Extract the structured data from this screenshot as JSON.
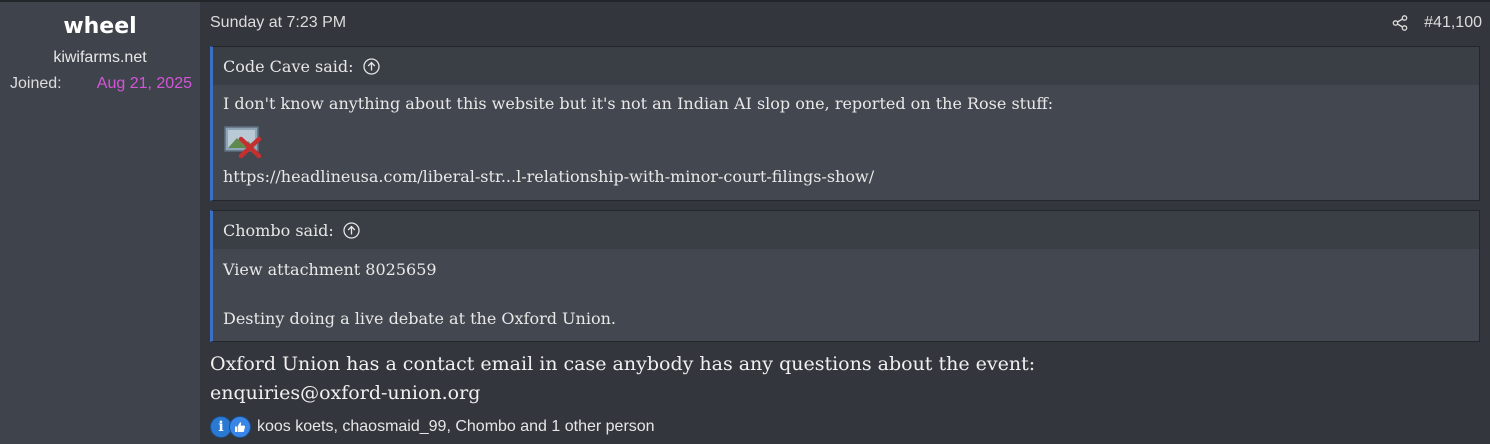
{
  "user": {
    "name": "wheel",
    "title": "kiwifarms.net",
    "joined_label": "Joined:",
    "joined_date": "Aug 21, 2025"
  },
  "post": {
    "date": "Sunday at 7:23 PM",
    "number": "#41,100",
    "quotes": [
      {
        "author": "Code Cave said:",
        "line1": "I don't know anything about this website but it's not an Indian AI slop one, reported on the Rose stuff:",
        "link": "https://headlineusa.com/liberal-str...l-relationship-with-minor-court-filings-show/"
      },
      {
        "author": "Chombo said:",
        "line1": "View attachment 8025659",
        "line2": "Destiny doing a live debate at the Oxford Union."
      }
    ],
    "body_line1": "Oxford Union has a contact email in case anybody has any questions about the event:",
    "body_line2": "enquiries@oxford-union.org",
    "reactions_text": "koos koets, chaosmaid_99, Chombo and 1 other person"
  },
  "icons": {
    "share": "share-icon",
    "quote_jump": "arrow-up-circle-icon",
    "broken_image": "broken-image-icon",
    "reaction_info": "informative-reaction-icon",
    "reaction_like": "like-reaction-icon"
  },
  "colors": {
    "joined_date": "#d455d9",
    "quote_border": "#3d6fc7",
    "background": "#33363d"
  }
}
